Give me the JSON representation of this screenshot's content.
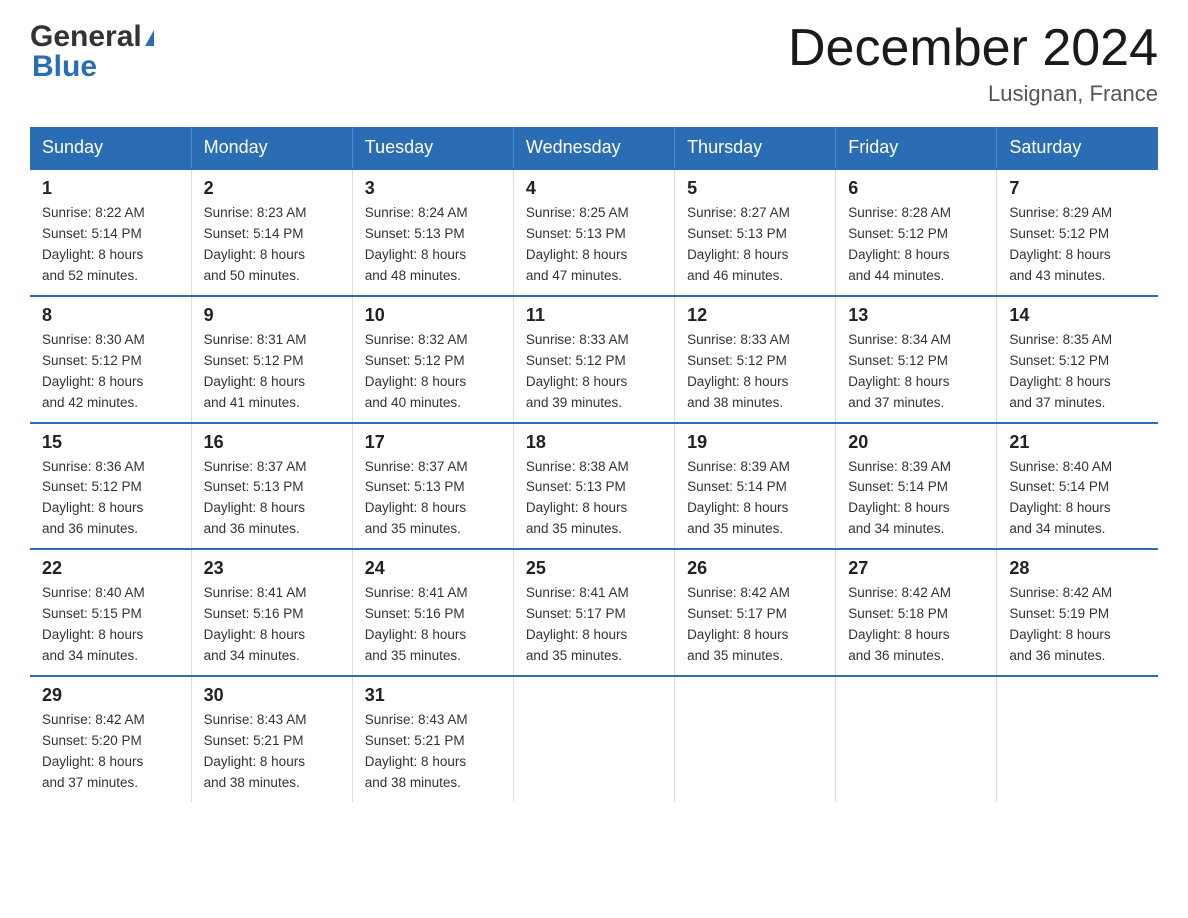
{
  "header": {
    "logo_general": "General",
    "logo_blue": "Blue",
    "title": "December 2024",
    "subtitle": "Lusignan, France"
  },
  "columns": [
    "Sunday",
    "Monday",
    "Tuesday",
    "Wednesday",
    "Thursday",
    "Friday",
    "Saturday"
  ],
  "weeks": [
    [
      {
        "day": "1",
        "info": "Sunrise: 8:22 AM\nSunset: 5:14 PM\nDaylight: 8 hours\nand 52 minutes."
      },
      {
        "day": "2",
        "info": "Sunrise: 8:23 AM\nSunset: 5:14 PM\nDaylight: 8 hours\nand 50 minutes."
      },
      {
        "day": "3",
        "info": "Sunrise: 8:24 AM\nSunset: 5:13 PM\nDaylight: 8 hours\nand 48 minutes."
      },
      {
        "day": "4",
        "info": "Sunrise: 8:25 AM\nSunset: 5:13 PM\nDaylight: 8 hours\nand 47 minutes."
      },
      {
        "day": "5",
        "info": "Sunrise: 8:27 AM\nSunset: 5:13 PM\nDaylight: 8 hours\nand 46 minutes."
      },
      {
        "day": "6",
        "info": "Sunrise: 8:28 AM\nSunset: 5:12 PM\nDaylight: 8 hours\nand 44 minutes."
      },
      {
        "day": "7",
        "info": "Sunrise: 8:29 AM\nSunset: 5:12 PM\nDaylight: 8 hours\nand 43 minutes."
      }
    ],
    [
      {
        "day": "8",
        "info": "Sunrise: 8:30 AM\nSunset: 5:12 PM\nDaylight: 8 hours\nand 42 minutes."
      },
      {
        "day": "9",
        "info": "Sunrise: 8:31 AM\nSunset: 5:12 PM\nDaylight: 8 hours\nand 41 minutes."
      },
      {
        "day": "10",
        "info": "Sunrise: 8:32 AM\nSunset: 5:12 PM\nDaylight: 8 hours\nand 40 minutes."
      },
      {
        "day": "11",
        "info": "Sunrise: 8:33 AM\nSunset: 5:12 PM\nDaylight: 8 hours\nand 39 minutes."
      },
      {
        "day": "12",
        "info": "Sunrise: 8:33 AM\nSunset: 5:12 PM\nDaylight: 8 hours\nand 38 minutes."
      },
      {
        "day": "13",
        "info": "Sunrise: 8:34 AM\nSunset: 5:12 PM\nDaylight: 8 hours\nand 37 minutes."
      },
      {
        "day": "14",
        "info": "Sunrise: 8:35 AM\nSunset: 5:12 PM\nDaylight: 8 hours\nand 37 minutes."
      }
    ],
    [
      {
        "day": "15",
        "info": "Sunrise: 8:36 AM\nSunset: 5:12 PM\nDaylight: 8 hours\nand 36 minutes."
      },
      {
        "day": "16",
        "info": "Sunrise: 8:37 AM\nSunset: 5:13 PM\nDaylight: 8 hours\nand 36 minutes."
      },
      {
        "day": "17",
        "info": "Sunrise: 8:37 AM\nSunset: 5:13 PM\nDaylight: 8 hours\nand 35 minutes."
      },
      {
        "day": "18",
        "info": "Sunrise: 8:38 AM\nSunset: 5:13 PM\nDaylight: 8 hours\nand 35 minutes."
      },
      {
        "day": "19",
        "info": "Sunrise: 8:39 AM\nSunset: 5:14 PM\nDaylight: 8 hours\nand 35 minutes."
      },
      {
        "day": "20",
        "info": "Sunrise: 8:39 AM\nSunset: 5:14 PM\nDaylight: 8 hours\nand 34 minutes."
      },
      {
        "day": "21",
        "info": "Sunrise: 8:40 AM\nSunset: 5:14 PM\nDaylight: 8 hours\nand 34 minutes."
      }
    ],
    [
      {
        "day": "22",
        "info": "Sunrise: 8:40 AM\nSunset: 5:15 PM\nDaylight: 8 hours\nand 34 minutes."
      },
      {
        "day": "23",
        "info": "Sunrise: 8:41 AM\nSunset: 5:16 PM\nDaylight: 8 hours\nand 34 minutes."
      },
      {
        "day": "24",
        "info": "Sunrise: 8:41 AM\nSunset: 5:16 PM\nDaylight: 8 hours\nand 35 minutes."
      },
      {
        "day": "25",
        "info": "Sunrise: 8:41 AM\nSunset: 5:17 PM\nDaylight: 8 hours\nand 35 minutes."
      },
      {
        "day": "26",
        "info": "Sunrise: 8:42 AM\nSunset: 5:17 PM\nDaylight: 8 hours\nand 35 minutes."
      },
      {
        "day": "27",
        "info": "Sunrise: 8:42 AM\nSunset: 5:18 PM\nDaylight: 8 hours\nand 36 minutes."
      },
      {
        "day": "28",
        "info": "Sunrise: 8:42 AM\nSunset: 5:19 PM\nDaylight: 8 hours\nand 36 minutes."
      }
    ],
    [
      {
        "day": "29",
        "info": "Sunrise: 8:42 AM\nSunset: 5:20 PM\nDaylight: 8 hours\nand 37 minutes."
      },
      {
        "day": "30",
        "info": "Sunrise: 8:43 AM\nSunset: 5:21 PM\nDaylight: 8 hours\nand 38 minutes."
      },
      {
        "day": "31",
        "info": "Sunrise: 8:43 AM\nSunset: 5:21 PM\nDaylight: 8 hours\nand 38 minutes."
      },
      {
        "day": "",
        "info": ""
      },
      {
        "day": "",
        "info": ""
      },
      {
        "day": "",
        "info": ""
      },
      {
        "day": "",
        "info": ""
      }
    ]
  ]
}
